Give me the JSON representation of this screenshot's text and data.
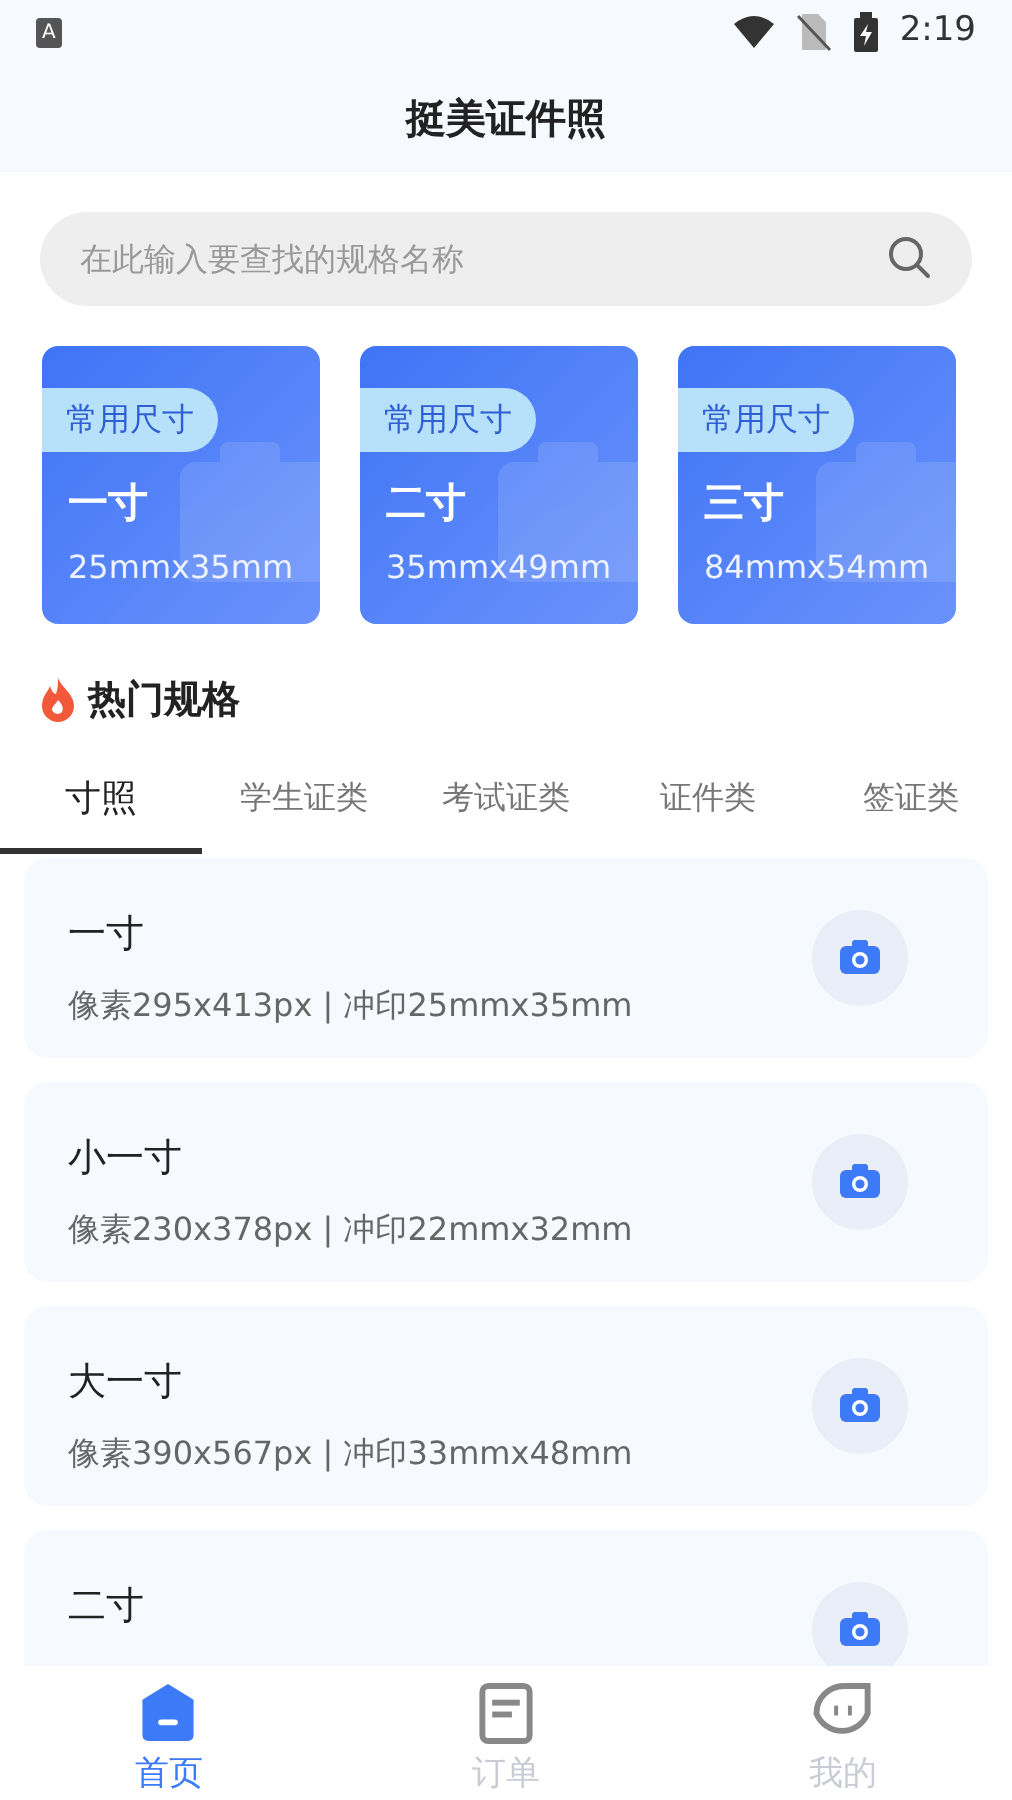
{
  "status_bar": {
    "time": "2:19",
    "app_badge": "A"
  },
  "header": {
    "title": "挺美证件照"
  },
  "search": {
    "placeholder": "在此输入要查找的规格名称"
  },
  "featured": [
    {
      "badge": "常用尺寸",
      "name": "一寸",
      "size": "25mmx35mm"
    },
    {
      "badge": "常用尺寸",
      "name": "二寸",
      "size": "35mmx49mm"
    },
    {
      "badge": "常用尺寸",
      "name": "三寸",
      "size": "84mmx54mm"
    }
  ],
  "section": {
    "title": "热门规格"
  },
  "tabs": [
    {
      "label": "寸照",
      "selected": true
    },
    {
      "label": "学生证类",
      "selected": false
    },
    {
      "label": "考试证类",
      "selected": false
    },
    {
      "label": "证件类",
      "selected": false
    },
    {
      "label": "签证类",
      "selected": false
    }
  ],
  "specs": [
    {
      "name": "一寸",
      "detail": "像素295x413px | 冲印25mmx35mm"
    },
    {
      "name": "小一寸",
      "detail": "像素230x378px | 冲印22mmx32mm"
    },
    {
      "name": "大一寸",
      "detail": "像素390x567px | 冲印33mmx48mm"
    },
    {
      "name": "二寸"
    }
  ],
  "bottom_nav": [
    {
      "label": "首页",
      "selected": true,
      "kind": "home"
    },
    {
      "label": "订单",
      "selected": false,
      "kind": "orders"
    },
    {
      "label": "我的",
      "selected": false,
      "kind": "profile"
    }
  ]
}
